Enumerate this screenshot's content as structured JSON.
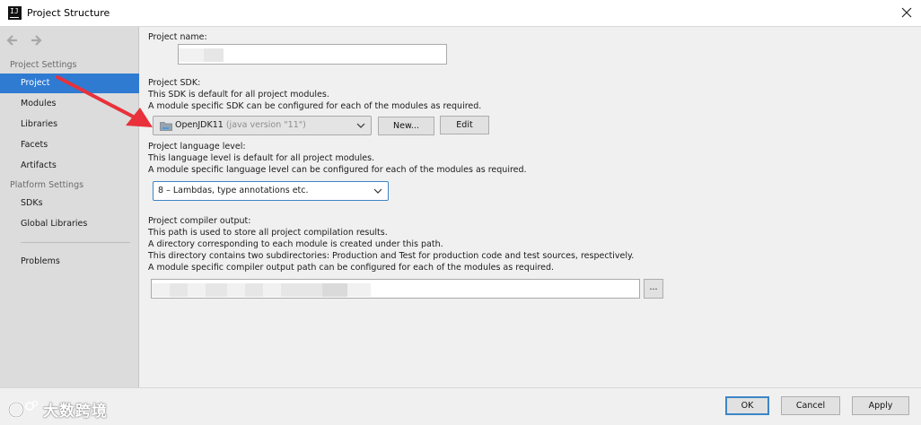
{
  "window": {
    "title": "Project Structure",
    "app_icon_text": "IJ"
  },
  "sidebar": {
    "project_settings_heading": "Project Settings",
    "project_items": [
      {
        "label": "Project",
        "selected": true
      },
      {
        "label": "Modules"
      },
      {
        "label": "Libraries"
      },
      {
        "label": "Facets"
      },
      {
        "label": "Artifacts"
      }
    ],
    "platform_settings_heading": "Platform Settings",
    "platform_items": [
      {
        "label": "SDKs"
      },
      {
        "label": "Global Libraries"
      }
    ],
    "problems_label": "Problems"
  },
  "main": {
    "project_name": {
      "label": "Project name:",
      "value": ""
    },
    "sdk": {
      "label": "Project SDK:",
      "desc1": "This SDK is default for all project modules.",
      "desc2": "A module specific SDK can be configured for each of the modules as required.",
      "selected": "OpenJDK11",
      "selected_detail": "(java version \"11\")",
      "new_button": "New...",
      "edit_button": "Edit"
    },
    "language_level": {
      "label": "Project language level:",
      "desc1": "This language level is default for all project modules.",
      "desc2": "A module specific language level can be configured for each of the modules as required.",
      "selected": "8 – Lambdas, type annotations etc."
    },
    "compiler_output": {
      "label": "Project compiler output:",
      "desc1": "This path is used to store all project compilation results.",
      "desc2": "A directory corresponding to each module is created under this path.",
      "desc3": "This directory contains two subdirectories: Production and Test for production code and test sources, respectively.",
      "desc4": "A module specific compiler output path can be configured for each of the modules as required.",
      "value": "",
      "browse_button": "..."
    }
  },
  "footer": {
    "ok": "OK",
    "cancel": "Cancel",
    "apply": "Apply"
  },
  "watermark": {
    "text": "大数跨境"
  },
  "colors": {
    "selection": "#2f7bd2",
    "annotation_arrow": "#e8313a",
    "focus_border": "#3d85c6"
  }
}
